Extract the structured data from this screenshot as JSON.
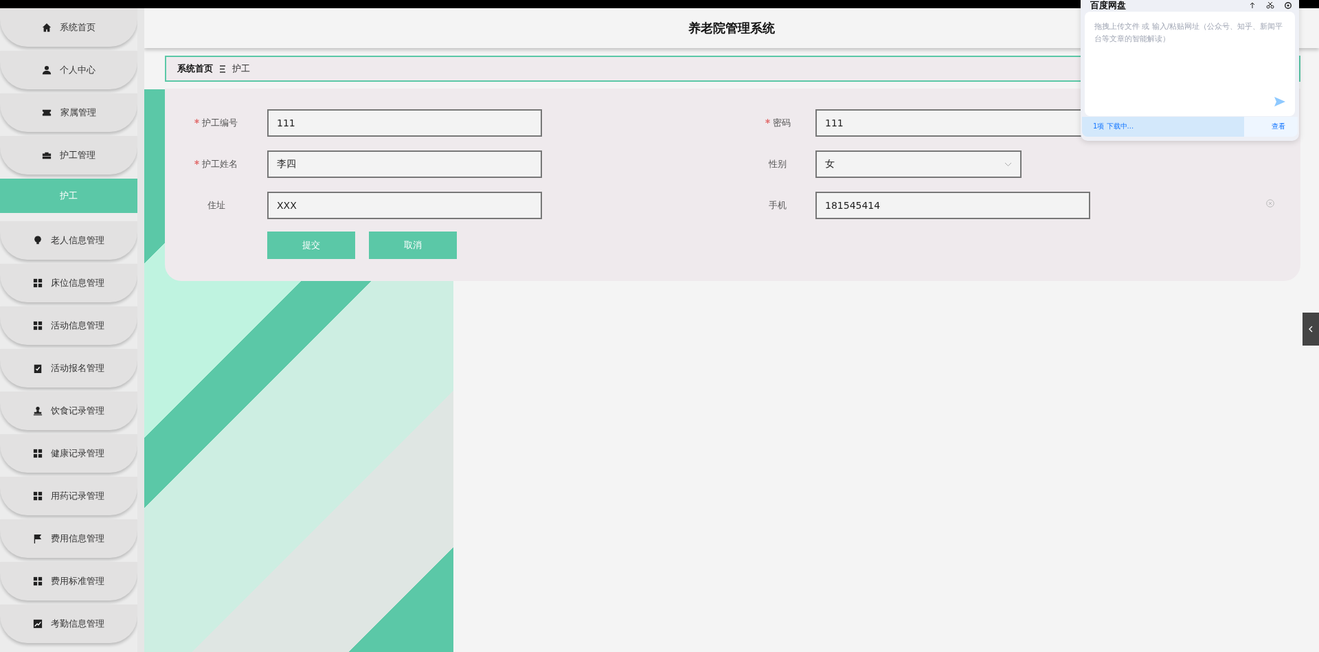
{
  "sidebar": {
    "items": [
      {
        "label": "系统首页",
        "selected": false
      },
      {
        "label": "个人中心",
        "selected": false
      },
      {
        "label": "家属管理",
        "selected": false
      },
      {
        "label": "护工管理",
        "selected": false
      },
      {
        "label": "护工",
        "selected": true
      },
      {
        "label": "老人信息管理",
        "selected": false
      },
      {
        "label": "床位信息管理",
        "selected": false
      },
      {
        "label": "活动信息管理",
        "selected": false
      },
      {
        "label": "活动报名管理",
        "selected": false
      },
      {
        "label": "饮食记录管理",
        "selected": false
      },
      {
        "label": "健康记录管理",
        "selected": false
      },
      {
        "label": "用药记录管理",
        "selected": false
      },
      {
        "label": "费用信息管理",
        "selected": false
      },
      {
        "label": "费用标准管理",
        "selected": false
      },
      {
        "label": "考勤信息管理",
        "selected": false
      }
    ]
  },
  "header": {
    "title": "养老院管理系统"
  },
  "breadcrumb": {
    "items": [
      "系统首页",
      "护工"
    ]
  },
  "form": {
    "fields": [
      {
        "label": "护工编号",
        "required": true,
        "kind": "text",
        "value": "111"
      },
      {
        "label": "密码",
        "required": true,
        "kind": "text",
        "value": "111"
      },
      {
        "label": "护工姓名",
        "required": true,
        "kind": "text",
        "value": "李四"
      },
      {
        "label": "性别",
        "required": false,
        "kind": "select",
        "value": "女"
      },
      {
        "label": "住址",
        "required": false,
        "kind": "text",
        "value": "XXX"
      },
      {
        "label": "手机",
        "required": false,
        "kind": "text",
        "value": "181545414"
      }
    ],
    "buttons": [
      "提交",
      "取消"
    ]
  },
  "popup": {
    "title": "百度网盘",
    "placeholder": "拖拽上传文件 或 输入/粘贴网址（公众号、知乎、新闻平台等文章的智能解读）",
    "status": "1项 下载中...",
    "link": "查看"
  }
}
